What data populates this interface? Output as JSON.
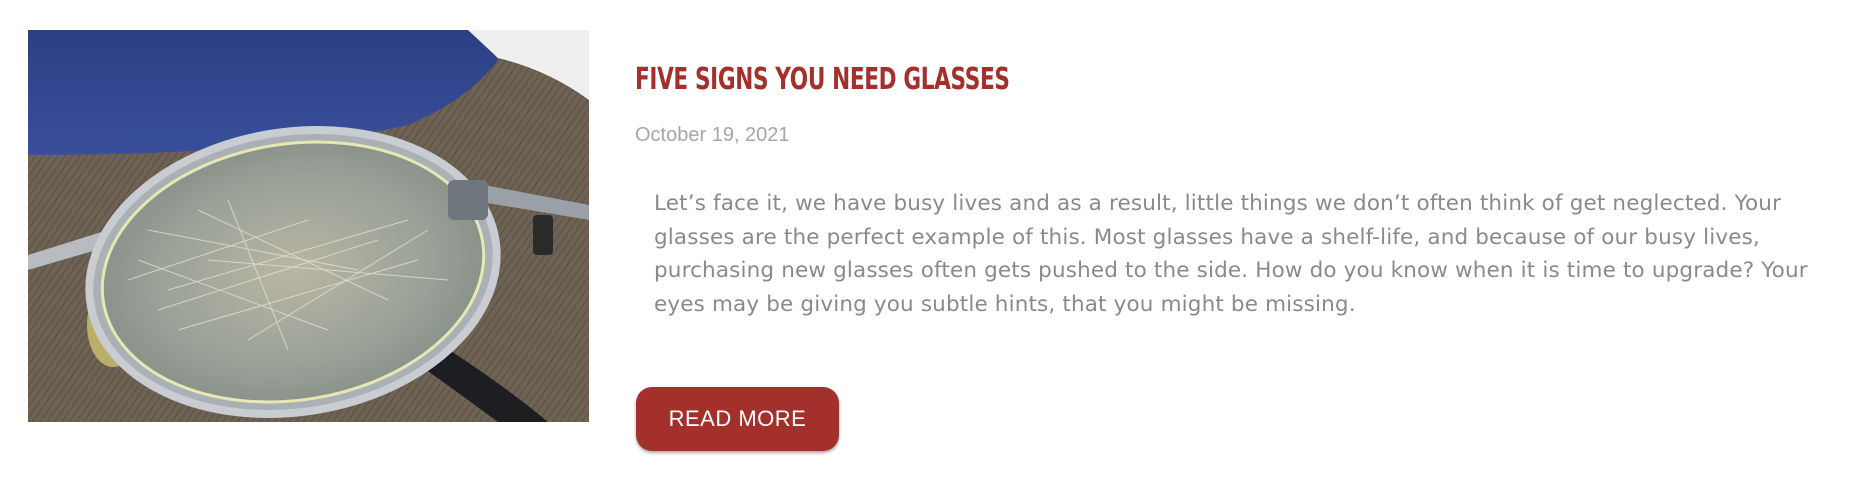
{
  "post": {
    "title": "Five Signs You Need Glasses",
    "date": "October 19, 2021",
    "excerpt": "Let’s face it, we have busy lives and as a result, little things we don’t often think of get neglected. Your glasses are the perfect example of this. Most glasses have a shelf-life, and because of our busy lives, purchasing new glasses often gets pushed to the side. How do you know when it is time to upgrade? Your eyes may be giving you subtle hints, that you might be missing.",
    "read_more_label": "READ MORE",
    "image_alt": "scratched eyeglasses lens"
  },
  "colors": {
    "accent": "#a4302b",
    "date_text": "#a6a6a6",
    "body_text": "#8a8a8a"
  }
}
